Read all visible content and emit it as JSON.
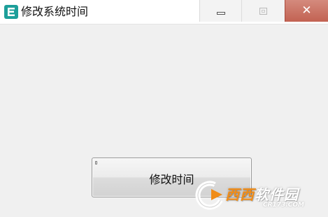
{
  "window": {
    "title": "修改系统时间",
    "app_icon": "app-icon-easy-glyph",
    "controls": {
      "minimize_icon": "minimize-icon",
      "maximize_icon": "maximize-icon",
      "close_icon": "close-icon",
      "close_color": "#c96a5b"
    }
  },
  "main": {
    "button_label": "修改时间"
  },
  "watermark": {
    "name_part1": "西西",
    "name_part2": "软件园",
    "url": "CR173.COM",
    "accent_color": "#f08c17"
  }
}
